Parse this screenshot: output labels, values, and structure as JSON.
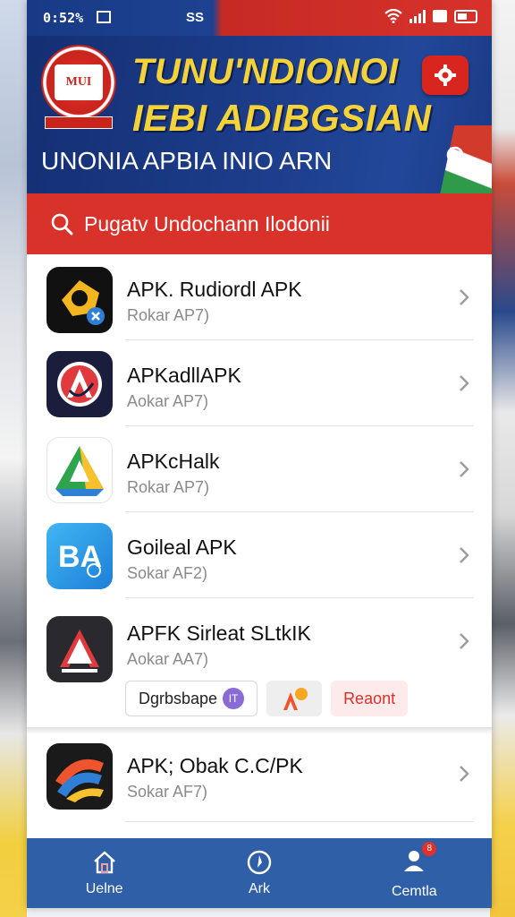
{
  "status_bar": {
    "time": "0:52%",
    "carrier": "SS"
  },
  "banner": {
    "logo_text": "MUI",
    "title_line1": "TUNU'NDIONOI",
    "title_line2": "IEBI ADIBGSIAN",
    "subtitle": "UNONIA APBIA INIO ARN"
  },
  "search": {
    "placeholder": "Pugatv Undochann Ilodonii"
  },
  "apps": [
    {
      "name": "APK. Rudiordl APK",
      "sub": "Rokar AP7)"
    },
    {
      "name": "APKadllAPK",
      "sub": "Aokar AP7)"
    },
    {
      "name": "APKcHalk",
      "sub": "Rokar AP7)"
    },
    {
      "name": "Goileal APK",
      "sub": "Sokar AF2)"
    },
    {
      "name": "APFK Sirleat SLtkIK",
      "sub": "Aokar AA7)"
    },
    {
      "name": "APK; Obak C.C/PK",
      "sub": "Sokar AF7)"
    }
  ],
  "chips": {
    "chip1_label": "Dgrbsbape",
    "chip1_badge": "IT",
    "chip3_label": "Reaont"
  },
  "bottom_nav": {
    "home_label": "Uelne",
    "center_label": "Ark",
    "profile_label": "Cemtla",
    "profile_badge": "8"
  },
  "colors": {
    "banner_blue": "#1d3e8c",
    "title_yellow": "#f4d23a",
    "search_red": "#d8322a",
    "nav_blue": "#2f5fa6"
  },
  "icons": [
    "image-icon",
    "wifi-icon",
    "signal-icon",
    "battery-icon",
    "search-icon",
    "chevron-right-icon",
    "home-icon",
    "compass-icon",
    "user-icon"
  ]
}
